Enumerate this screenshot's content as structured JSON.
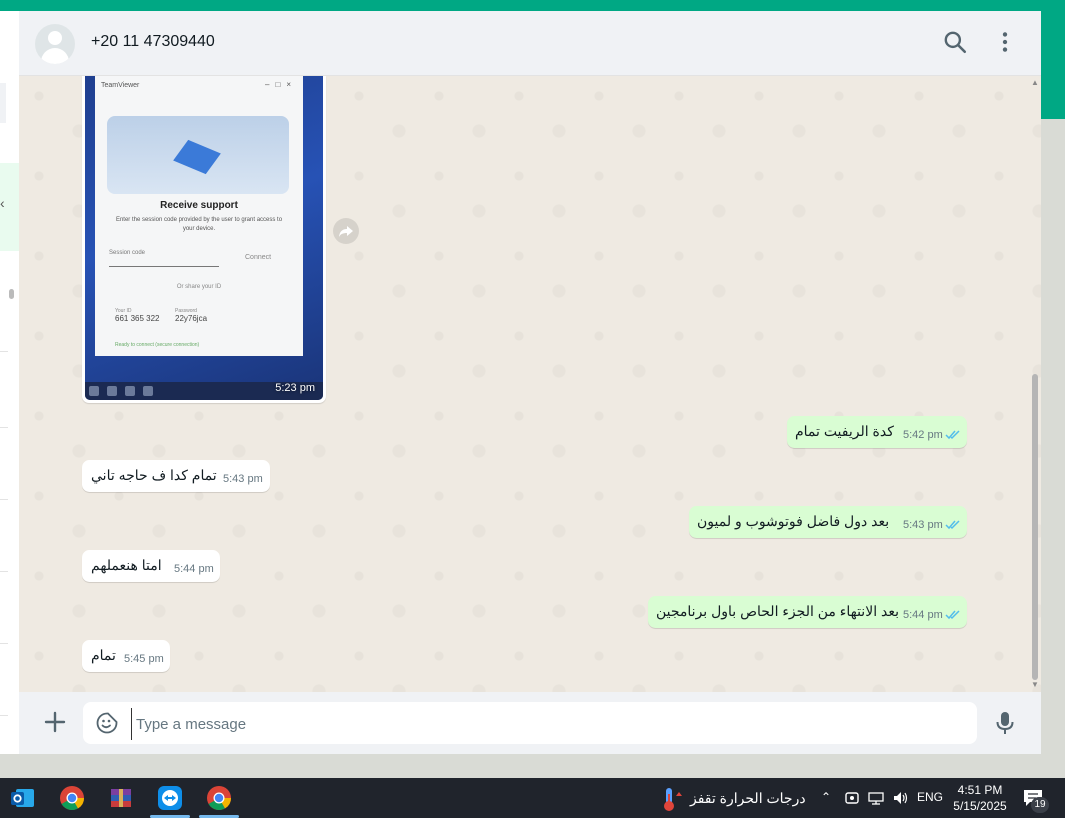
{
  "header": {
    "contact_name": "+20 11 47309440",
    "icons": [
      "search-icon",
      "menu-dots-icon"
    ]
  },
  "image_message": {
    "time": "5:23 pm",
    "screen_app": "TeamViewer",
    "screen_title": "Receive support",
    "screen_desc": "Enter the session code provided by the user to grant access to your device.",
    "screen_field": "Session code",
    "screen_button": "Connect",
    "screen_share": "Or share your ID",
    "screen_id_label": "Your ID",
    "screen_id": "661 365 322",
    "screen_pwd_label": "Password",
    "screen_pwd": "22y76jca",
    "screen_note": "Ready to connect (secure connection)"
  },
  "messages": [
    {
      "dir": "out",
      "text": "كدة الريفيت تمام",
      "time": "5:42 pm"
    },
    {
      "dir": "in",
      "text": "تمام كدا ف حاجه تاني",
      "time": "5:43 pm"
    },
    {
      "dir": "out",
      "text": "بعد دول فاضل فوتوشوب و لميون",
      "time": "5:43 pm"
    },
    {
      "dir": "in",
      "text": "امتا هنعملهم",
      "time": "5:44 pm"
    },
    {
      "dir": "out",
      "text": "بعد الانتهاء من الجزء الحاص باول برنامجين",
      "time": "5:44 pm"
    },
    {
      "dir": "in",
      "text": "تمام",
      "time": "5:45 pm"
    }
  ],
  "composer": {
    "placeholder": "Type a message",
    "value": ""
  },
  "colors": {
    "accent": "#00a884",
    "outgoing_bubble": "#d9fdd3",
    "read_ticks": "#53bdeb"
  },
  "taskbar": {
    "weather_text": "درجات الحرارة تقفز",
    "language": "ENG",
    "time": "4:51 PM",
    "date": "5/15/2025",
    "notification_count": "19",
    "apps": [
      "outlook-icon",
      "chrome-icon",
      "winrar-icon",
      "teamviewer-icon",
      "chrome-icon"
    ]
  }
}
